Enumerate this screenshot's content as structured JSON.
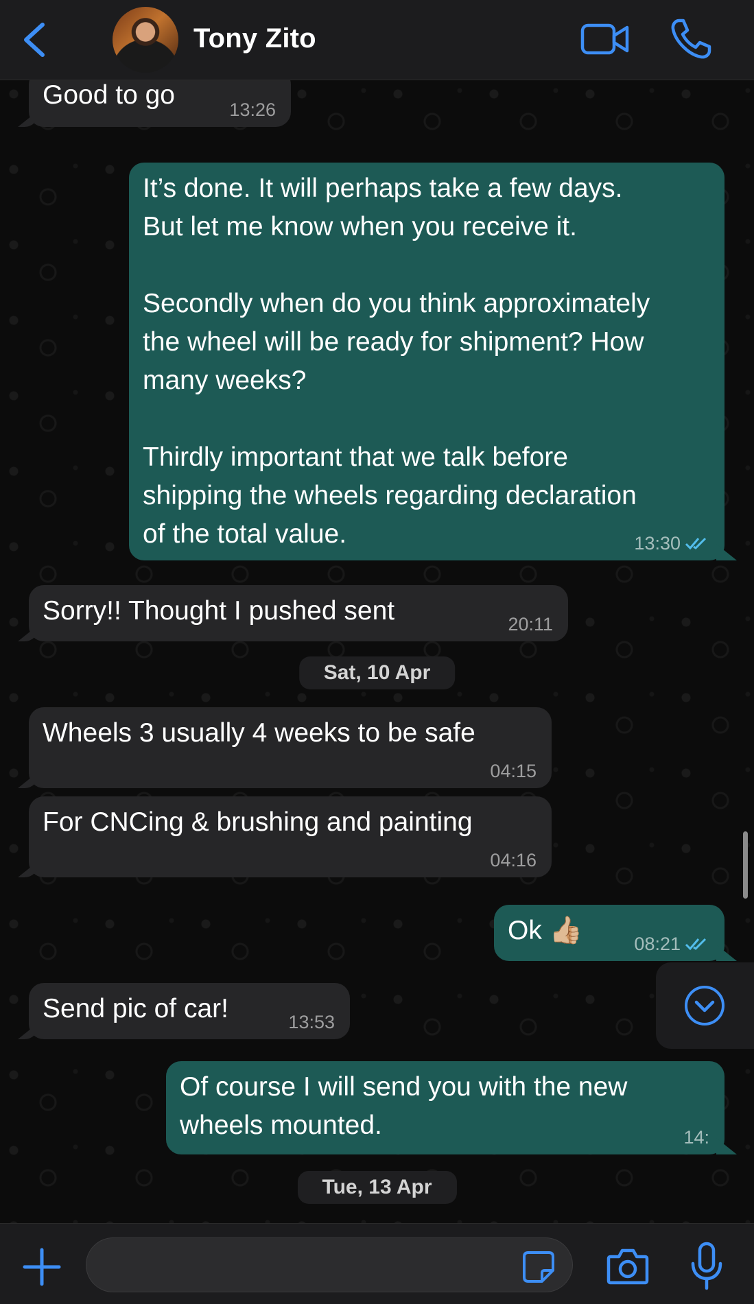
{
  "header": {
    "contact_name": "Tony Zito"
  },
  "icons": {
    "back": "chevron-left-icon",
    "video": "video-camera-icon",
    "call": "phone-icon",
    "scroll_down": "chevron-down-circle-icon",
    "plus": "plus-icon",
    "sticker": "sticker-icon",
    "camera": "camera-icon",
    "mic": "microphone-icon"
  },
  "colors": {
    "accent": "#3d8ef5",
    "incoming_bubble": "#262628",
    "outgoing_bubble": "#1d5a55",
    "read_ticks": "#53bdeb"
  },
  "messages": [
    {
      "direction": "in",
      "text": "Good to go",
      "time": "13:26"
    },
    {
      "direction": "out",
      "text": "It’s done. It will perhaps take a few days.\nBut let me know when you receive it.\n\nSecondly when do you think approximately\nthe wheel will be ready for shipment? How\nmany weeks?\n\nThirdly important that we talk before\nshipping the wheels regarding declaration\nof the total value.",
      "time": "13:30",
      "status": "read"
    },
    {
      "direction": "in",
      "text": "Sorry!! Thought I pushed sent",
      "time": "20:11"
    },
    {
      "direction": "in",
      "text": "Wheels 3 usually 4 weeks to be safe",
      "time": "04:15"
    },
    {
      "direction": "in",
      "text": "For CNCing & brushing and painting",
      "time": "04:16"
    },
    {
      "direction": "out",
      "text": "Ok 👍🏼",
      "time": "08:21",
      "status": "read"
    },
    {
      "direction": "in",
      "text": "Send pic of car!",
      "time": "13:53"
    },
    {
      "direction": "out",
      "text": "Of course I will send you with the new\nwheels mounted.",
      "time": "14:"
    }
  ],
  "date_separators": [
    "Sat, 10 Apr",
    "Tue, 13 Apr"
  ],
  "composer": {
    "value": "",
    "placeholder": ""
  }
}
